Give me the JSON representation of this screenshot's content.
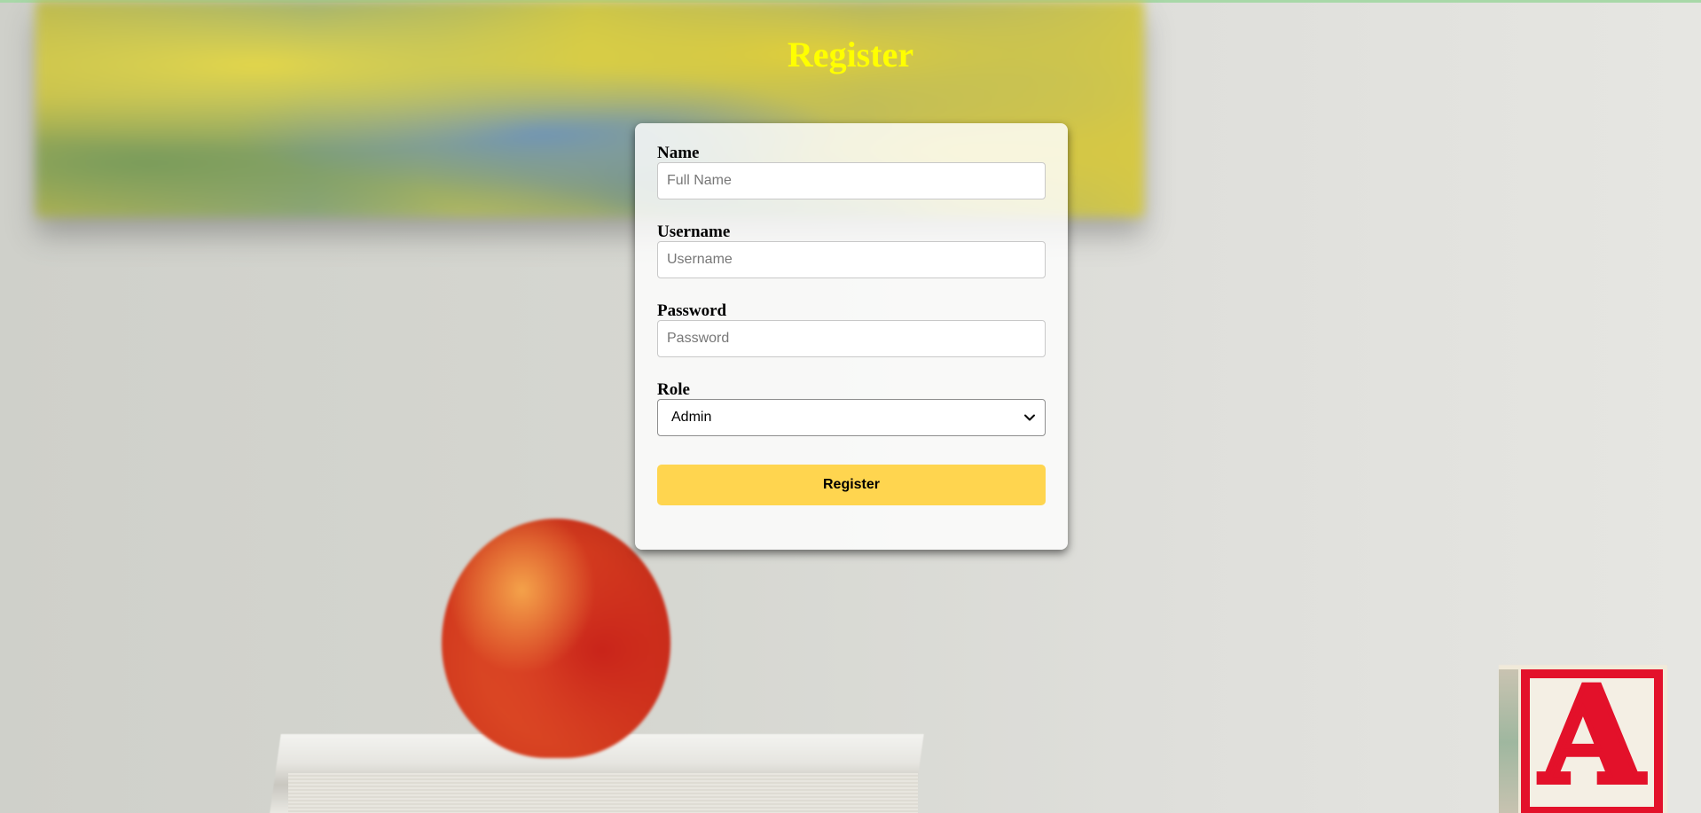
{
  "page": {
    "title": "Register"
  },
  "form": {
    "name": {
      "label": "Name",
      "placeholder": "Full Name",
      "value": ""
    },
    "username": {
      "label": "Username",
      "placeholder": "Username",
      "value": ""
    },
    "password": {
      "label": "Password",
      "placeholder": "Password",
      "value": ""
    },
    "role": {
      "label": "Role",
      "selected": "Admin"
    },
    "submit_label": "Register"
  },
  "background": {
    "block_letter": "A"
  },
  "colors": {
    "title": "#ffff00",
    "button": "#ffd54f",
    "block_red": "#e3112a"
  }
}
